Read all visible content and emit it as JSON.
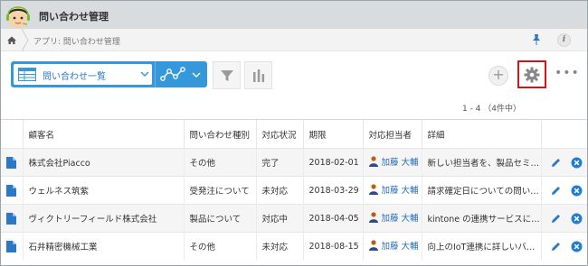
{
  "app": {
    "title": "問い合わせ管理",
    "breadcrumb": "アプリ: 問い合わせ管理"
  },
  "toolbar": {
    "view_label": "問い合わせ一覧",
    "add_symbol": "+",
    "more_symbol": "•••"
  },
  "pager": {
    "text": "1 - 4 （4件中）"
  },
  "table": {
    "headers": [
      "顧客名",
      "問い合わせ種別",
      "対応状況",
      "期限",
      "対応担当者",
      "詳細"
    ],
    "rows": [
      {
        "customer": "株式会社Piacco",
        "type": "その他",
        "status": "完了",
        "deadline": "2018-02-01",
        "assignee": "加藤 大輔",
        "detail": "新しい担当者を、製品セミ…"
      },
      {
        "customer": "ウェルネス筑紫",
        "type": "受発注について",
        "status": "未対応",
        "deadline": "2018-03-29",
        "assignee": "加藤 大輔",
        "detail": "請求確定日についての問い…"
      },
      {
        "customer": "ヴィクトリーフィールド株式会社",
        "type": "製品について",
        "status": "対応中",
        "deadline": "2018-04-05",
        "assignee": "加藤 大輔",
        "detail": "kintone の連携サービスに…"
      },
      {
        "customer": "石井精密機械工業",
        "type": "その他",
        "status": "未対応",
        "deadline": "2018-08-15",
        "assignee": "加藤 大輔",
        "detail": "向上のIoT連携に詳しいバ…"
      }
    ]
  },
  "colors": {
    "header_bg": "#d9dcde",
    "accent_blue": "#3498db",
    "link_blue": "#2b6fb3",
    "highlight_red": "#d0141c",
    "delete_blue": "#1f7fd6"
  },
  "icons": [
    "avatar",
    "home-icon",
    "pin-icon",
    "info-icon",
    "table-view-icon",
    "chevron-down-icon",
    "graph-icon",
    "filter-icon",
    "bar-chart-icon",
    "plus-icon",
    "gear-icon",
    "more-icon",
    "document-icon",
    "person-icon",
    "pencil-icon",
    "delete-icon"
  ]
}
